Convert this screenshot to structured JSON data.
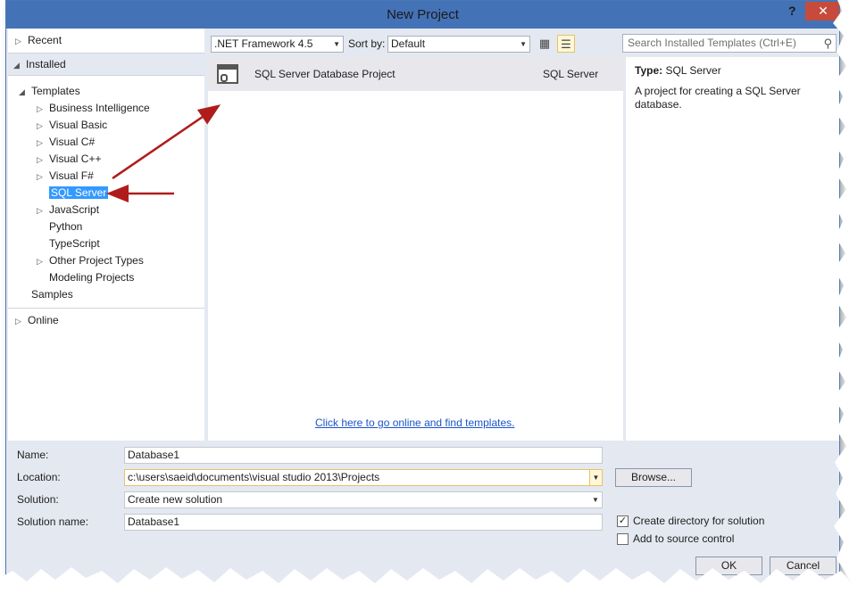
{
  "window": {
    "title": "New Project",
    "help_glyph": "?",
    "close_glyph": "✕"
  },
  "nav": {
    "recent": "Recent",
    "installed": "Installed",
    "templates": "Templates",
    "items": [
      {
        "label": "Business Intelligence",
        "expandable": true
      },
      {
        "label": "Visual Basic",
        "expandable": true
      },
      {
        "label": "Visual C#",
        "expandable": true
      },
      {
        "label": "Visual C++",
        "expandable": true
      },
      {
        "label": "Visual F#",
        "expandable": true
      },
      {
        "label": "SQL Server",
        "expandable": false,
        "selected": true
      },
      {
        "label": "JavaScript",
        "expandable": true
      },
      {
        "label": "Python",
        "expandable": false
      },
      {
        "label": "TypeScript",
        "expandable": false
      },
      {
        "label": "Other Project Types",
        "expandable": true
      },
      {
        "label": "Modeling Projects",
        "expandable": false
      }
    ],
    "samples": "Samples",
    "online": "Online"
  },
  "toolbar": {
    "framework": ".NET Framework 4.5",
    "sort_label": "Sort by:",
    "sort_value": "Default",
    "search_placeholder": "Search Installed Templates (Ctrl+E)"
  },
  "templates": [
    {
      "name": "SQL Server Database Project",
      "type": "SQL Server"
    }
  ],
  "online_link": "Click here to go online and find templates.",
  "details": {
    "type_label": "Type:",
    "type_value": "SQL Server",
    "description": "A project for creating a SQL Server database."
  },
  "form": {
    "name_label": "Name:",
    "name_value": "Database1",
    "location_label": "Location:",
    "location_value": "c:\\users\\saeid\\documents\\visual studio 2013\\Projects",
    "solution_label": "Solution:",
    "solution_value": "Create new solution",
    "solution_name_label": "Solution name:",
    "solution_name_value": "Database1",
    "browse_label": "Browse...",
    "create_dir_label": "Create directory for solution",
    "create_dir_checked": true,
    "source_control_label": "Add to source control",
    "source_control_checked": false,
    "ok_label": "OK",
    "cancel_label": "Cancel"
  },
  "colors": {
    "titlebar": "#4472b7",
    "close": "#c74b3c",
    "selection": "#3399ff",
    "annotation_arrow": "#b01c1c",
    "link": "#1a55c9"
  }
}
